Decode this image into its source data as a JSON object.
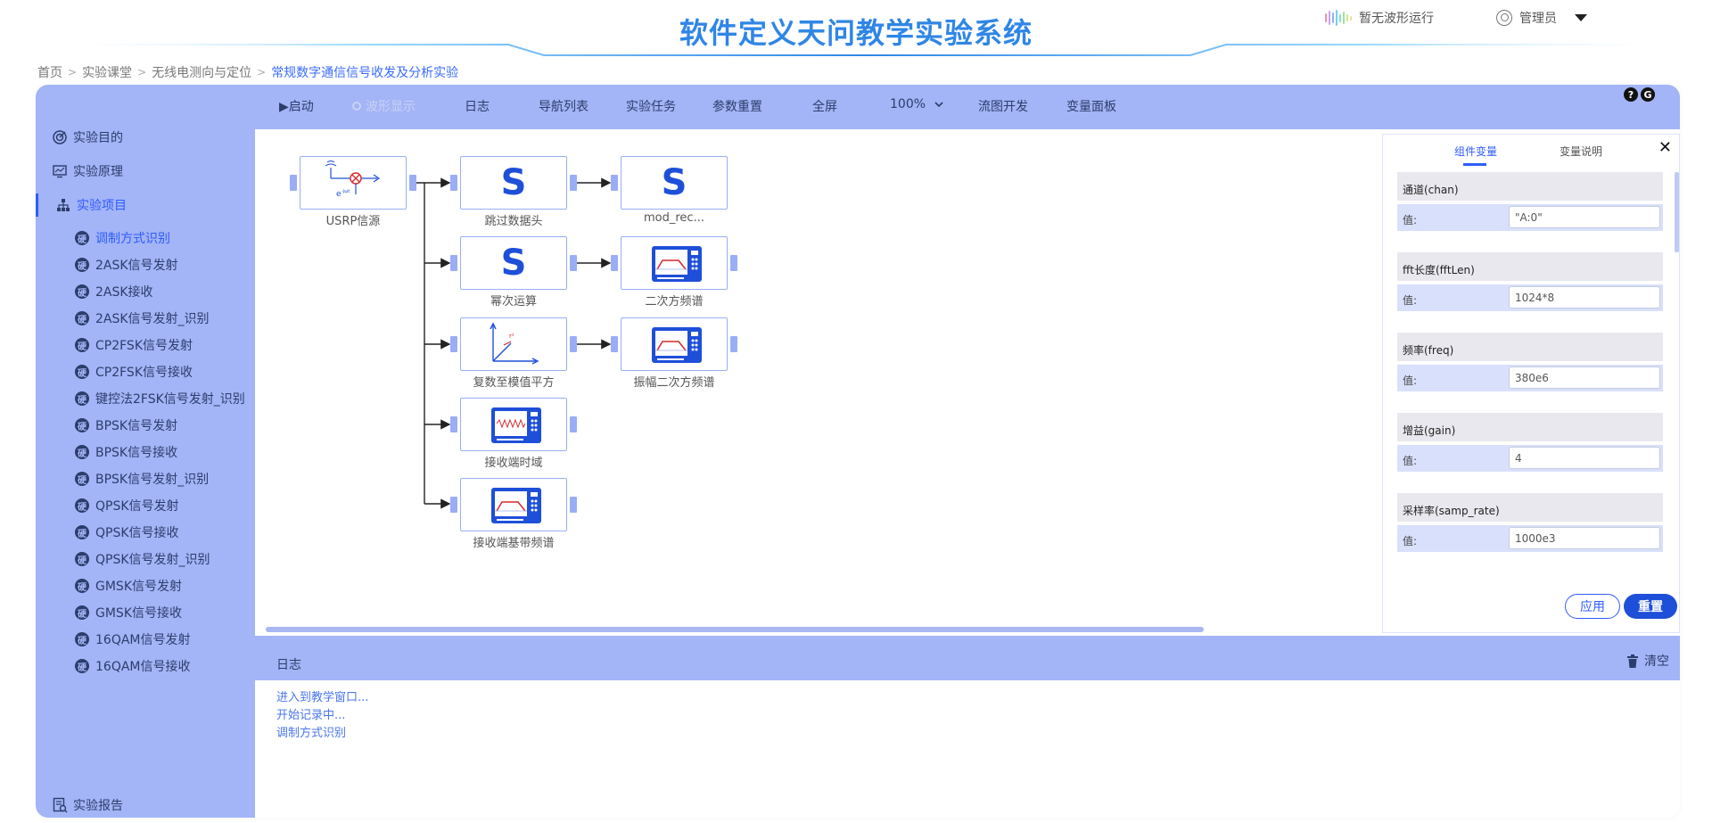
{
  "app": {
    "title": "软件定义天问教学实验系统",
    "wave_status": "暂无波形运行",
    "user_name": "管理员"
  },
  "breadcrumb": [
    "首页",
    "实验课堂",
    "无线电测向与定位",
    "常规数字通信信号收发及分析实验"
  ],
  "sidebar": {
    "top_items": [
      {
        "label": "实验目的",
        "icon": "target-icon"
      },
      {
        "label": "实验原理",
        "icon": "monitor-icon"
      },
      {
        "label": "实验项目",
        "icon": "hierarchy-icon"
      }
    ],
    "sub_icon_letter": "硬",
    "sub_items": [
      "调制方式识别",
      "2ASK信号发射",
      "2ASK接收",
      "2ASK信号发射_识别",
      "CP2FSK信号发射",
      "CP2FSK信号接收",
      "键控法2FSK信号发射_识别",
      "BPSK信号发射",
      "BPSK信号接收",
      "BPSK信号发射_识别",
      "QPSK信号发射",
      "QPSK信号接收",
      "QPSK信号发射_识别",
      "GMSK信号发射",
      "GMSK信号接收",
      "16QAM信号发射",
      "16QAM信号接收"
    ],
    "bottom_item": {
      "label": "实验报告",
      "icon": "report-icon"
    }
  },
  "toolbar": {
    "start": "▶启动",
    "waveform": "波形显示",
    "log": "日志",
    "nav_list": "导航列表",
    "tasks": "实验任务",
    "reset_params": "参数重置",
    "fullscreen": "全屏",
    "zoom": "100%",
    "flow_dev": "流图开发",
    "var_panel": "变量面板",
    "help_icons": [
      "?",
      "G"
    ]
  },
  "flowgraph": {
    "blocks": {
      "usrp": "USRP信源",
      "skip_header": "跳过数据头",
      "mod_rec": "mod_rec...",
      "power": "幂次运算",
      "sq_spectrum": "二次方频谱",
      "complex_mag": "复数至模值平方",
      "amp_sq_spectrum": "振幅二次方频谱",
      "rx_time": "接收端时域",
      "rx_baseband": "接收端基带频谱"
    },
    "script_symbol": "S",
    "usrp_formula": "e",
    "usrp_exponent": "-jωt",
    "plot_symbol": "r²"
  },
  "var_panel": {
    "tabs": [
      "组件变量",
      "变量说明"
    ],
    "close": "✕",
    "value_label": "值:",
    "variables": [
      {
        "name": "通道(chan)",
        "value": "\"A:0\""
      },
      {
        "name": "fft长度(fftLen)",
        "value": "1024*8"
      },
      {
        "name": "频率(freq)",
        "value": "380e6"
      },
      {
        "name": "增益(gain)",
        "value": "4"
      },
      {
        "name": "采样率(samp_rate)",
        "value": "1000e3"
      }
    ],
    "apply": "应用",
    "reset": "重置"
  },
  "log": {
    "title": "日志",
    "clear": "清空",
    "lines": [
      "进入到教学窗口...",
      "开始记录中...",
      "调制方式识别"
    ]
  },
  "colors": {
    "accent": "#2f5cff",
    "panel_bg": "#a3b4f7",
    "title": "#2f86e6"
  }
}
